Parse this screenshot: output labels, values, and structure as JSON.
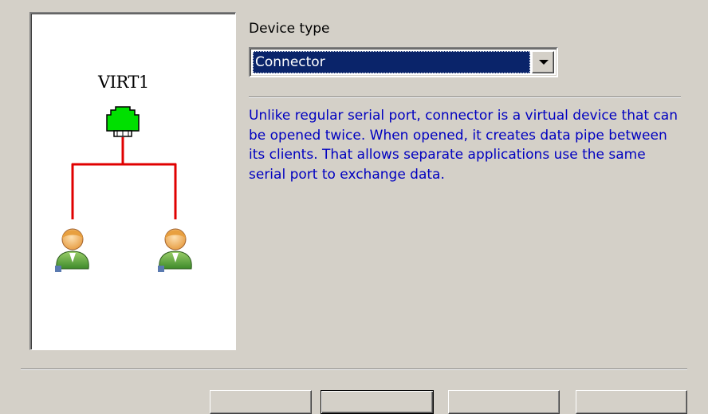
{
  "diagram": {
    "device_label": "VIRT1",
    "connector_icon": "connector-icon",
    "client_icons": [
      "user-icon",
      "user-icon"
    ],
    "colors": {
      "connector": "#00e000",
      "wire": "#e00000"
    }
  },
  "device_type": {
    "label": "Device type",
    "selected": "Connector",
    "arrow_icon": "chevron-down-icon"
  },
  "description": "Unlike regular serial port, connector is a virtual device that can be opened twice. When opened, it creates data pipe between its clients. That allows separate applications use the same serial port to exchange data.",
  "colors": {
    "description_text": "#0000c0",
    "selection_bg": "#0a246a",
    "dialog_bg": "#d4d0c8"
  }
}
